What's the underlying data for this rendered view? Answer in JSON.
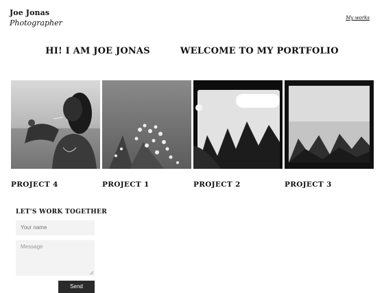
{
  "header": {
    "name": "Joe Jonas",
    "tagline": "Photographer",
    "nav_link": "My works"
  },
  "hero": {
    "greeting": "HI! I AM JOE JONAS",
    "welcome": "WELCOME TO MY PORTFOLIO"
  },
  "projects": [
    {
      "title": "PROJECT 4",
      "image": "portrait-smoking-bw"
    },
    {
      "title": "PROJECT 1",
      "image": "white-flowers-bw"
    },
    {
      "title": "PROJECT 2",
      "image": "film-frame-plants-bw"
    },
    {
      "title": "PROJECT 3",
      "image": "foggy-field-bw"
    }
  ],
  "contact": {
    "heading": "LET'S WORK TOGETHER",
    "name_placeholder": "Your name",
    "message_placeholder": "Message",
    "send_label": "Send"
  }
}
